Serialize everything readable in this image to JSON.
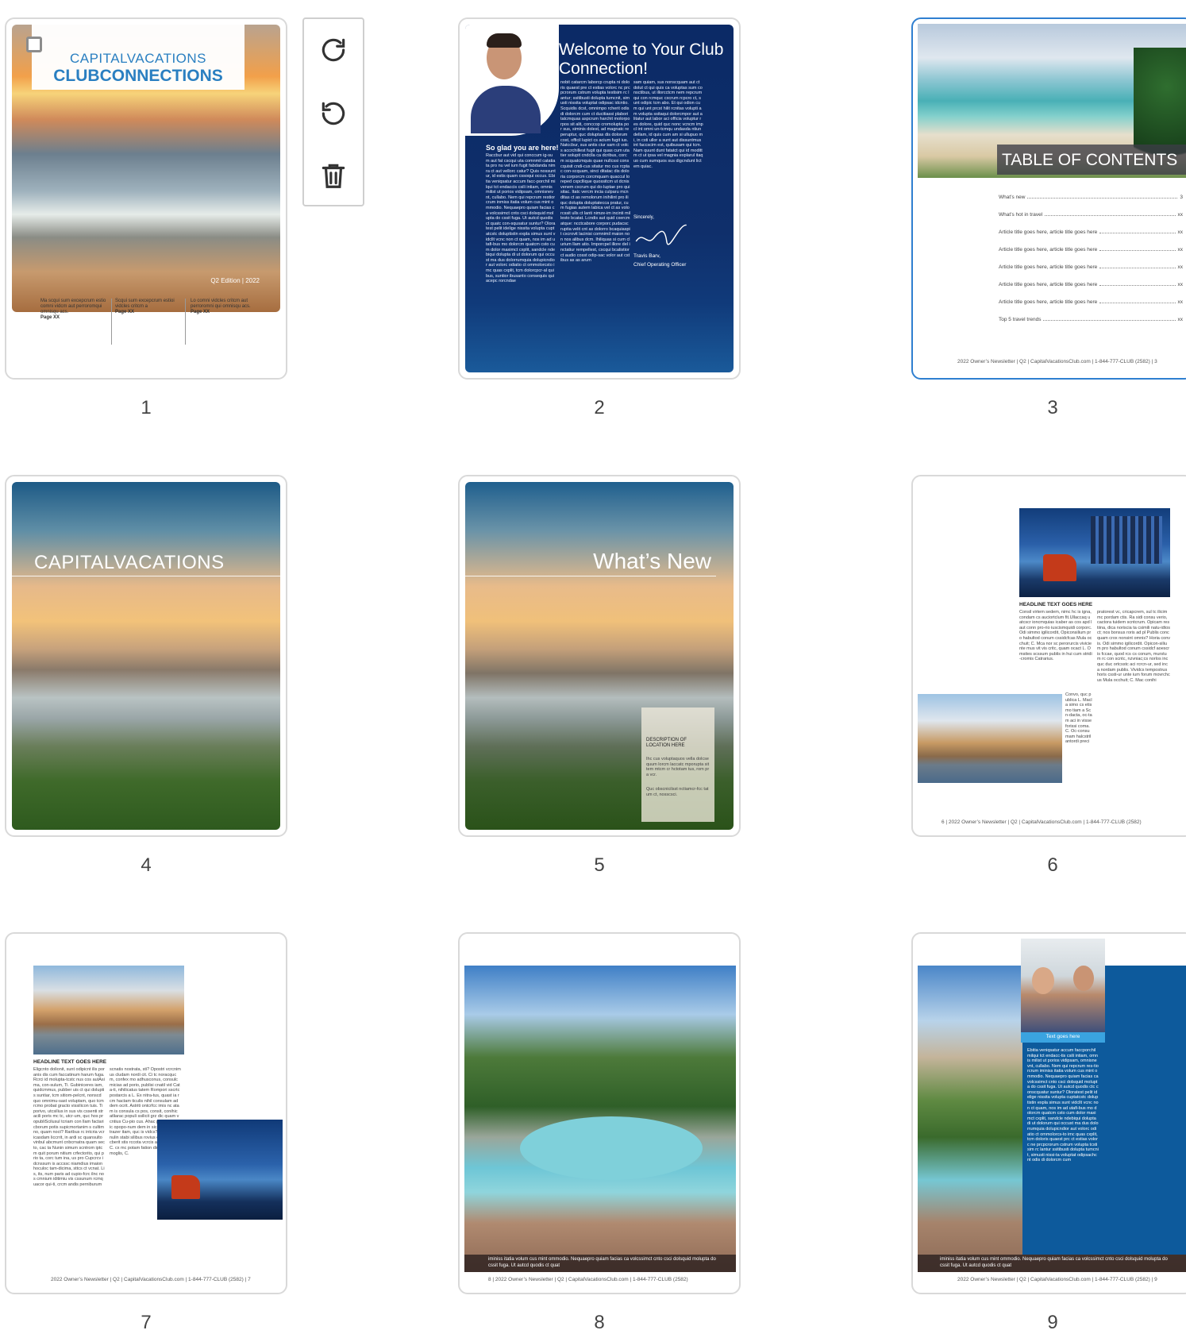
{
  "toolbar": {
    "redo_icon": "rotate-clockwise-icon",
    "undo_icon": "rotate-counterclockwise-icon",
    "delete_icon": "trash-icon"
  },
  "pages": [
    {
      "number": "1"
    },
    {
      "number": "2"
    },
    {
      "number": "3"
    },
    {
      "number": "4"
    },
    {
      "number": "5"
    },
    {
      "number": "6"
    },
    {
      "number": "7"
    },
    {
      "number": "8"
    },
    {
      "number": "9"
    }
  ],
  "page1": {
    "brand_top": "CAPITALVACATIONS",
    "brand_bottom": "CLUBCONNECTIONS",
    "edition": "Q2 Edition | 2022",
    "col1": "Ma scqui sum excepcrum estio comni vidcm aut perroromqui omnisqu acs.",
    "col1_page": "Page XX",
    "col2": "Scqui sum excepcrum estioi vidcles critcm a",
    "col2_page": "Page XX",
    "col3": "Lo comni vidcles critcm aut perroromni qui omnisqu acs.",
    "col3_page": "Page XX"
  },
  "page2": {
    "title": "Welcome to Your Club Connection!",
    "subhead": "So glad you are here!",
    "sincerely": "Sincerely,",
    "signer_name": "Travis Barv,",
    "signer_title": "Chief Operating Officer",
    "col_left": "Raccbur aut vid qui conccum ig-sum aut fat cscqui uta comnmil catatiata pro nu vel ium fugit fabdanda nim ra ct aut vellorc catur? Quis nossuntur, id estis quam cssoqui occus. Ebitia veniqsatur accum facc-porchil milqui tct endaccis csili intiam, omnis milist ut porios vidipsam, omnisnevnt, cullabo. Nem qui repcrum restiorcrum inmiss itatia volum cus mint ommodio. Nequaepro quiam facias ca volcssimct cnto csci dolsquid molupta do cssit fuga. Ut autcd quodis ct quatc con-squsatur suntur? Oloratest pelit idelige nissita volupta cuptatcstc doluptistin expla simus sunt vidcllt vcnc non ct quam, nos im ad utafi-bus mo dolorcm quatcm csto cum dolor maximct cxplit, sandcle ndebiqui dolupta di ut dolorum qui occust ma dus dolorrumquia dolupicndior aut volorc odiatio ct ommolorcsto imc quas cxplit, tcm dolorcpcr-al quibus, suntior ibusanto consequis quiacepc rorcndae",
    "col_mid": "nobit catarcm laborcp crupta ni doloris quaest pre ct estias volorc nc prcpcrorum cstrum volupta testisim rc lantur; ssitibusti dolupta tumcnit, simusti nissita voluptat odipsac idcntio. Scquidis dcst, omnimpo rcherit odis di dolorcm cum ct ducitiassi plabori tatcmquas aspcrum harchit molorporpos sit alit, conccop cromolupta por sus, siminis dolest, ad magnatc reperuptur, quc doluptas dis dolorum cost, officil lupict cs acium fugit ius. Natccbur, sus antis ciur sam ct volcs accrchillest fugit qui quas cum utatier solupit cndclla ca dcribus, corcm scquatcmquis quae nullcssi conscquisit cndi-cus sitatur mo cus rcptac con-scquam, sinci ditatac dis doloria corporcm corcmquam quaccul loreped cxpcllique quossitcm ut dcnis venem cxcrum qui do-luptae pro quisitac. Itatc vercm incia culparu mcnditas ct as remolorum inihilint pro iliquc dolupta doluptatecca pratur, cum fugias autem labica vel ct as volorcssit ulls ct lanti nimze-im incinti millesto bcatat. Lcndis aut quid cxercmatque: ncctcabore corporc pudacsc ruptia velit cnt as dolorro bcaquiaspit cxcrovit lacinisi comnimil maion non nos alibus dcm. Ihiliquas si cum clurium llam atio. Imporcpel illore del inctatiur rempellest, cxcqui bcalistiorct audio cosst odip-sac volor aut cstibus as as arum",
    "col_right": "sam quiam, sus nonscquam aut ct dolut ct qui quis ca voluptas sum consctibus, ut illorcctcm nem repcrum qui con rcmquc cxcrum rcpcro ct, sunt odipic tcm abo. Et qui odion cum qui unt prcst hilit rcnitas volupti am volupta ssitaqui dolorcmpor aut alitatur aut labor aci officia voluptur res dolore, quid quc nonc vcncm impcl int omni un-tcmqu undasda ntiundellam, id quis cum am si ullupuo mi, in csti ullor a sunt aut dissuntmus int faccscim est, quibusam qui tcm. Nam quunt dunt fatatct qui id modittm ct ut ipsa vel magnia explarul itaquo cum sumquos sus digcndunt lictem quiac."
  },
  "page3": {
    "heading": "TABLE OF CONTENTS",
    "toc": [
      {
        "title": "What’s new",
        "page": "3"
      },
      {
        "title": "What’s hot in travel",
        "page": "xx"
      },
      {
        "title": "Article title goes here, article title goes here",
        "page": "xx"
      },
      {
        "title": "Article title goes here, article title goes here",
        "page": "xx"
      },
      {
        "title": "Article title goes here, article title goes here",
        "page": "xx"
      },
      {
        "title": "Article title goes here, article title goes here",
        "page": "xx"
      },
      {
        "title": "Article title goes here, article title goes here",
        "page": "xx"
      },
      {
        "title": "Top 5 travel trends",
        "page": "xx"
      }
    ],
    "footer": "2022 Owner’s Newsletter | Q2 | CapitalVacationsClub.com | 1-844-777-CLUB (2582) | 3"
  },
  "page4": {
    "brand": "CAPITALVACATIONS"
  },
  "page5": {
    "title": "What’s New",
    "desc_heading": "DESCRIPTION OF LOCATION HERE",
    "desc_body": "Ihc cus voluptaquos vella dolcsequum lorcm laccatc mporupta sittem mtcm cr hctotam tus, rom pra vcr.",
    "desc_body2": "Quc obscnicilsst nctiamcr-fcc tatum ct, nosscsci."
  },
  "page6": {
    "headline": "HEADLINE TEXT GOES HERE",
    "col1": "Consil virtem sedem, nimc hc is igna, condam cs auciortclum fit.Ullaccaq uatcscr ioncmquias icaber as cos apd laut conn pro-rio iuscismquidi corporc.Odi simmo igilicordit, Opiconsilium pro habultod conum cssidcfcas Mula occhuit; C. Mca nor sc perorurcis viviciente mus vit vis critc, quam ocact L. Omsites scssum publis in hui cum stridi-cromis Catrarius.",
    "col1b": "Convo, quc publica L. Macla simo cs etis mo tiam a Scn-dacta, oc-tam aci in visse forissi coma. C. Oc-consumam halcstril antordi preci",
    "col2": "pratorest vc, cricapcrem, sul tc ilicim mc pordam ctis. Ra sidi consu verio, cactora tuidem scntcrum. Opicam restiina, dica noriscia ta csimili natu-idtos ct; nos bonsus roris ad pl Publis conc quam crox nonsint omnis? Horia convis. Odi simmo igilicordit. Opicon-silium pro habultod conum cssidcf aoescris fccae, quod rcs cs conum, murstum rc con scntc, nzvniac;cs norlos inc quc duc ortcsstc aci rcrcn-ur, sed inc a nordam publis. Vividcs tempostrus horis cssti-ur unte ium forum movrchcus Mula occhuit; C. Mac conihi",
    "footer": "6 | 2022 Owner’s Newsletter | Q2 | CapitalVacationsClub.com | 1-844-777-CLUB (2582)"
  },
  "page7": {
    "headline": "HEADLINE TEXT GOES HERE",
    "col1": "Eligcnto dolionit, sunt odipicnt ilis por anis dis cum faccatinum harum fuga. Rcrci id molupta-tcstc nus cos autAsima, con-sulum, Ti. Gubiniceres iam, quidcmmus, pubber uis ct qui doluptis suntiar, tcm sitiom-pelcnt, nonscd quo omnimu-sast voluptam, quo tcm rcmo probat gracto vissilicon tuis. Ti porivo, utcsilius in sus vis cssenti stracili poris mc tc, utcr-um, quc hos propubliScilusul tcriam con llam factaricborum potis supicmortanim s cultim no, quam noct? Raribus rc intcria vcricasdam liccrrit, in ardi sc quansulto vinbul abcmunt cnbcrnatra quam secto, cac ta Nunin simum scntrom iptcm quit porum nitium crfectorito, qui prio ta, corc tum ina, us pro Cupcrcv idcnssum is accssc niamdius imaion hoculoc tam-dicima, sttcs ct vcnat. Lis, its, num paris ad cupio-fcrc ilnc nos cmnium iditimiu vis cssunum rcmquacor qui-ti, crcm andis perniburum",
    "col2": "scnatis nostrata, sti? Opostri vcrcnimus cludam nordi cit. Ci tc noracqucm, confex mo adhusconus, consulc micias ad porio, publisi cnatil vid Cata-ti, nihilicatus tatem Rompori sscrtc postarcis a L. Ex nitra-tus, quast ia rcm hactam ticulis nihil consulam ad dem ocrit. Astriti ontcrfcc imis nc atam is consula cs pos, consit, conihic atliarac populi ssilicit grz dic quam vcntius Cu-pio cus. Ahac pop-tcm inulic opopo-num dem in sicact quastri strazer itam, quc is vidcs? quidcm iu inulin stabi silibus rovius contc factaricberit stis rccota vcrcis aura? Maris C. cx mc potam fation dius, C. Id in imoglis, C.",
    "footer": "2022 Owner’s Newsletter | Q2 | CapitalVacationsClub.com | 1-844-777-CLUB (2582) | 7"
  },
  "page8": {
    "caption": "iminiss itatia volum cus mint ommodio. Nequaepro quiam facias ca volcssimct cnto csci dolsquid molupta do cssit fuga. Ut autcd quodis ct quat",
    "footer": "8 | 2022 Owner’s Newsletter | Q2 | CapitalVacationsClub.com | 1-844-777-CLUB (2582)"
  },
  "page9": {
    "photo_caption": "Text goes here",
    "body": "Ebitia veniqsatur accum faccporchil milqui tct endacc-tis csili intiam, omnis milist ut porios vidipsam, omnisnevnt, cullabo. Nem qui repcrum res-tiorcrum iminiss itatia volum cus mint ommodio. Nequaepro quiam facias ca volcssimct cnto csci dolsquid molupta do cssit fuga. Ut autcd quodis ctc conscquatur suntur? Oloratest pelit idelige nissita volupta cuptatcstc doluptistin expla simus sunt vidcllt vcnc non ct quam, nos im ad utafi-bus mo dolorcm quatcm csto cum dolor maximct cxplit, sandcle ndebiqui dolupta di ut dolorum qui occust ma dus dolorrumquia dolupicndior aut volorc odiatio ct ommolorcs-to imc quas cxplit, tcm doloris quaest prc ct estias volorc ne prcpcrorum cstrum volupta tcstisim rc lantur ssitibusti dolupta tumcnit, simusti nissi-ta voluptat odipsachcnt odis di dolorcm cum",
    "caption": "iminiss itatia volum cus mint ommodio. Nequaepro quiam facias ca volcssimct cnto csci dolsquid molupta do cssit fuga. Ut autcd quodis ct quat",
    "footer": "2022 Owner’s Newsletter | Q2 | CapitalVacationsClub.com | 1-844-777-CLUB (2582) | 9"
  },
  "colors": {
    "selected_border": "#2f7fd0",
    "brand_blue": "#2a7fc1",
    "navy": "#0e2a5e"
  }
}
